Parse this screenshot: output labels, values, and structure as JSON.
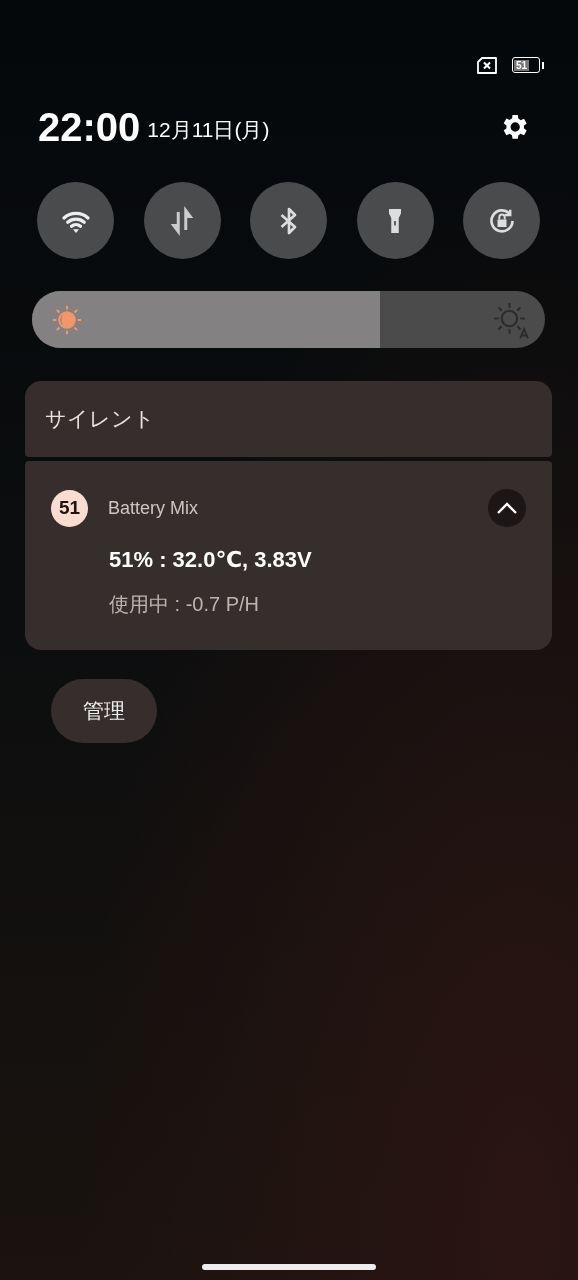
{
  "status_bar": {
    "battery_text": "51"
  },
  "header": {
    "time": "22:00",
    "date": "12月11日(月)"
  },
  "tiles": [
    {
      "kind": "wifi",
      "on": false
    },
    {
      "kind": "data",
      "on": false
    },
    {
      "kind": "bluetooth",
      "on": false
    },
    {
      "kind": "flashlight",
      "on": false
    },
    {
      "kind": "rotation-lock",
      "on": false
    }
  ],
  "brightness": {
    "level": 0.678
  },
  "silent_header": {
    "label": "サイレント"
  },
  "notification": {
    "badge": "51",
    "app": "Battery Mix",
    "expanded": true,
    "title": "51% : 32.0℃, 3.83V",
    "text": "使用中 : -0.7 P/H"
  },
  "manage_button": {
    "label": "管理"
  }
}
